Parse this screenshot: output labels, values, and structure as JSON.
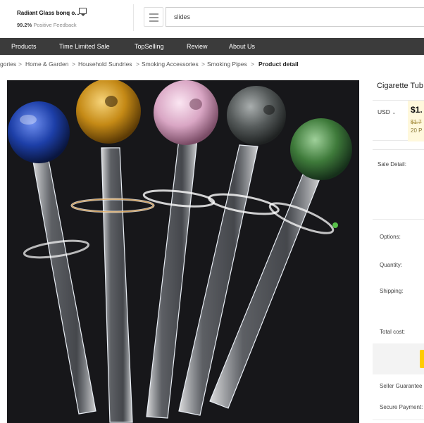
{
  "store": {
    "name": "Radiant Glass bonq o...",
    "feedback_percent": "99.2%",
    "feedback_label": "Positive Feedback"
  },
  "search": {
    "value": "slides"
  },
  "nav": {
    "items": [
      "Products",
      "Time Limited Sale",
      "TopSelling",
      "Review",
      "About Us"
    ]
  },
  "breadcrumb": {
    "items": [
      "gories",
      "Home & Garden",
      "Household Sundries",
      "Smoking Accessories",
      "Smoking Pipes",
      "Product detail"
    ],
    "separator": ">"
  },
  "product": {
    "title": "Cigarette Tub",
    "currency": "USD",
    "price": "$1.",
    "old_price": "$1.7",
    "min_order": "20 P",
    "sale_detail_label": "Sale Detail:",
    "options_label": "Options:",
    "quantity_label": "Quantity:",
    "shipping_label": "Shipping:",
    "total_cost_label": "Total cost:",
    "seller_guarantee_label": "Seller Guarantee",
    "secure_payment_label": "Secure Payment:"
  },
  "colors": {
    "nav_bg": "#3b3b3b",
    "price_bg": "#fff8dc",
    "buy_button": "#ffcc00",
    "photo_bg": "#17171a",
    "bulb_blue": "#1d3fa8",
    "bulb_amber": "#c58a16",
    "bulb_pink": "#d9a6c4",
    "bulb_smoke": "#555a5a",
    "bulb_green": "#3e7a3a"
  },
  "icons": {
    "chat": "chat-icon",
    "menu": "hamburger-menu-icon",
    "currency_dropdown": "chevron-down-icon"
  }
}
